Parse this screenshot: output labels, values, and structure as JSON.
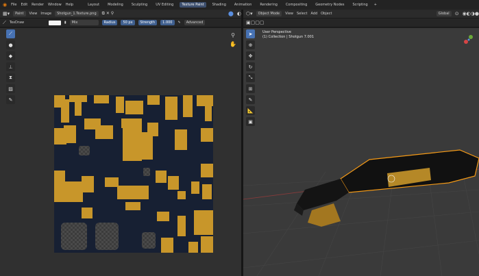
{
  "topbar": {
    "menus": [
      "File",
      "Edit",
      "Render",
      "Window",
      "Help"
    ],
    "workspaces": [
      "Layout",
      "Modeling",
      "Sculpting",
      "UV Editing",
      "Texture Paint",
      "Shading",
      "Animation",
      "Rendering",
      "Compositing",
      "Geometry Nodes",
      "Scripting"
    ],
    "active_workspace": "Texture Paint",
    "add_tab": "+"
  },
  "image_editor": {
    "mode": "Paint",
    "menus": [
      "View",
      "Image"
    ],
    "image_name": "Shotgun_1.Texture.png",
    "tool_name": "TexDraw",
    "blend": "Mix",
    "radius_label": "Radius",
    "radius_value": "50 px",
    "strength_label": "Strength",
    "strength_value": "1.000",
    "advanced": "Advanced"
  },
  "viewport": {
    "mode": "Object Mode",
    "menus": [
      "View",
      "Select",
      "Add",
      "Object"
    ],
    "transform": "Global",
    "perspective": "User Perspective",
    "collection": "(1) Collection | Shotgun 7.001"
  },
  "colors": {
    "accent": "#4772b3",
    "texture_gold": "#c8962a",
    "texture_dark": "#172033",
    "selection": "#f59a16"
  }
}
